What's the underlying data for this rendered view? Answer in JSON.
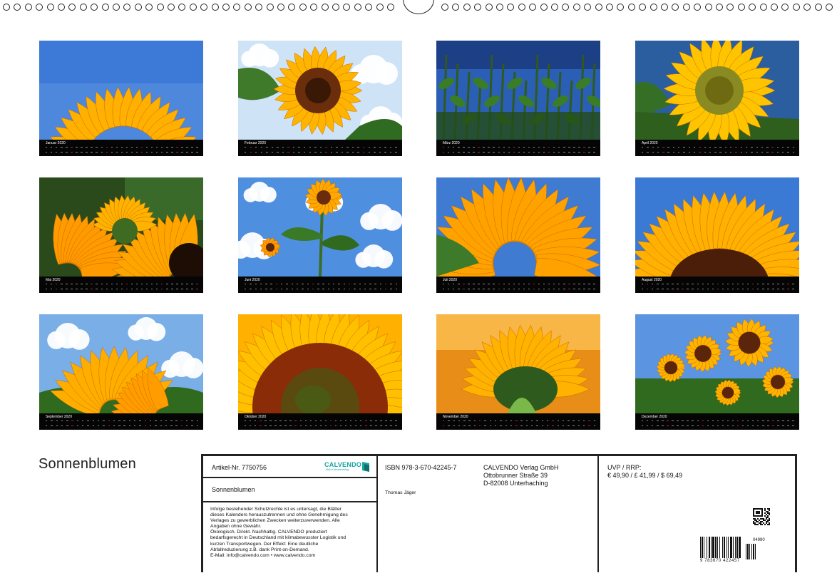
{
  "calendar": {
    "title": "Sonnenblumen",
    "months": [
      {
        "label": "Januar 2020"
      },
      {
        "label": "Februar 2020"
      },
      {
        "label": "März 2020"
      },
      {
        "label": "April 2020"
      },
      {
        "label": "Mai 2020"
      },
      {
        "label": "Juni 2020"
      },
      {
        "label": "Juli 2020"
      },
      {
        "label": "August 2020"
      },
      {
        "label": "September 2020"
      },
      {
        "label": "Oktober 2020"
      },
      {
        "label": "November 2020"
      },
      {
        "label": "Dezember 2020"
      }
    ]
  },
  "info": {
    "article": "Artikel-Nr. 7750756",
    "logo_word": "CALVENDO",
    "logo_sub": "Mein Kalenderverlag",
    "product_title": "Sonnenblumen",
    "legal_lines": [
      "Infolge bestehender Schutzrechte ist es untersagt, die Blätter",
      "dieses Kalenders herauszutrennen und ohne Genehmigung des",
      "Verlages zu gewerblichen Zwecken weiterzuverwenden. Alle",
      "Angaben ohne Gewähr.",
      "Ökologisch. Direkt. Nachhaltig. CALVENDO produziert",
      "bedarfsgerecht in Deutschland mit klimabewusster Logistik und",
      "kurzen Transportwegen. Der Effekt: Eine deutliche",
      "Abfallreduzierung z.B. dank Print-on-Demand.",
      "E-Mail: info@calvendo.com • www.calvendo.com"
    ],
    "isbn": "ISBN 978-3-670-42245-7",
    "author": "Thomas Jäger",
    "publisher_lines": [
      "CALVENDO Verlag GmbH",
      "Ottobrunner Straße 39",
      "D-82008 Unterhaching"
    ],
    "price_label": "UVP / RRP:",
    "price_value": "€ 49,90 / £ 41,99 / $ 69,49",
    "barcode_number": "9 783670 422457",
    "barcode_addon": "04990"
  }
}
